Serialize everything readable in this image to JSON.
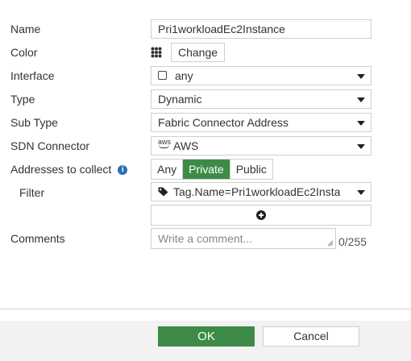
{
  "form": {
    "name": {
      "label": "Name",
      "value": "Pri1workloadEc2Instance"
    },
    "color": {
      "label": "Color",
      "icon": "color-palette-icon",
      "change_label": "Change"
    },
    "interface": {
      "label": "Interface",
      "value": "any",
      "icon": "checkbox-icon"
    },
    "type": {
      "label": "Type",
      "value": "Dynamic"
    },
    "sub_type": {
      "label": "Sub Type",
      "value": "Fabric Connector Address"
    },
    "sdn_connector": {
      "label": "SDN Connector",
      "value": "AWS",
      "icon_text": "aws"
    },
    "addresses_to_collect": {
      "label": "Addresses to collect",
      "info_icon": "i",
      "options": [
        "Any",
        "Private",
        "Public"
      ],
      "selected": "Private"
    },
    "filter": {
      "label": "Filter",
      "value": "Tag.Name=Pri1workloadEc2Insta",
      "icon": "tag-icon"
    },
    "comments": {
      "label": "Comments",
      "placeholder": "Write a comment...",
      "counter": "0/255"
    }
  },
  "footer": {
    "ok_label": "OK",
    "cancel_label": "Cancel"
  },
  "colors": {
    "accent": "#3d8b46",
    "info": "#2a6fb8",
    "border": "#cfcfcf",
    "footer_bg": "#f2f2f2"
  }
}
